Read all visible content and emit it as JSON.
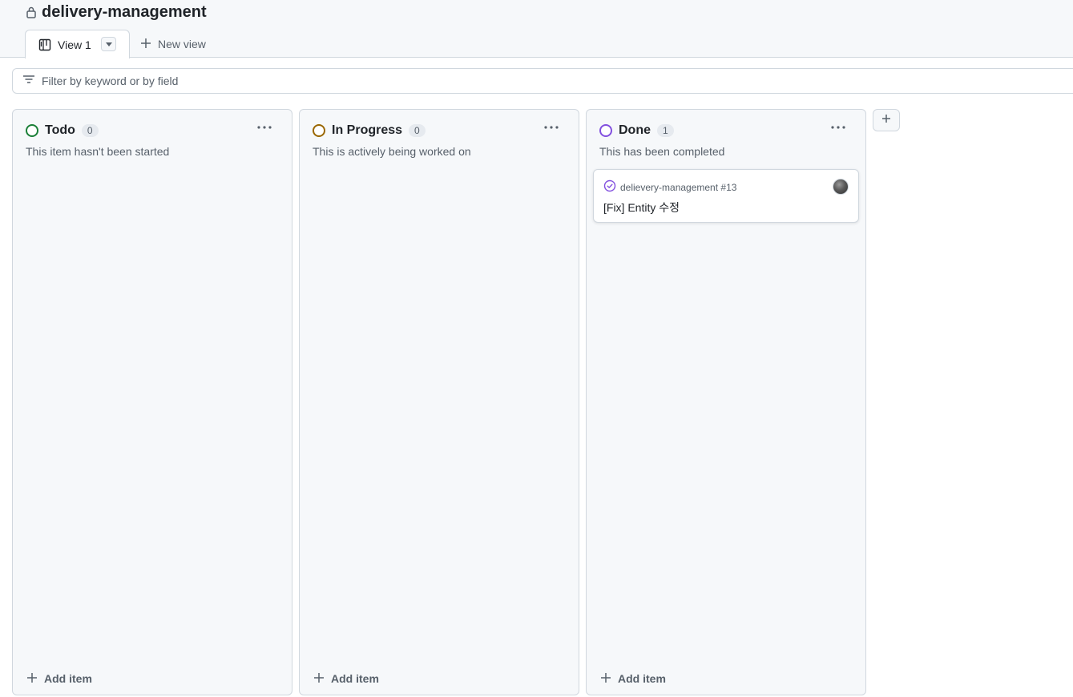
{
  "project": {
    "title": "delivery-management"
  },
  "tabs": {
    "active_label": "View 1",
    "new_view_label": "New view"
  },
  "filter": {
    "placeholder": "Filter by keyword or by field",
    "value": ""
  },
  "columns": [
    {
      "name": "Todo",
      "count": "0",
      "description": "This item hasn't been started",
      "status_color": "#1a7f37",
      "add_label": "Add item"
    },
    {
      "name": "In Progress",
      "count": "0",
      "description": "This is actively being worked on",
      "status_color": "#9a6700",
      "add_label": "Add item"
    },
    {
      "name": "Done",
      "count": "1",
      "description": "This has been completed",
      "status_color": "#8250df",
      "add_label": "Add item",
      "cards": [
        {
          "reference": "delievery-management #13",
          "title": "[Fix] Entity 수정",
          "icon": "issue-closed-icon",
          "icon_color": "#8250df"
        }
      ]
    }
  ],
  "icons": {
    "lock": "lock-icon",
    "board": "project-board-icon",
    "filter": "filter-icon",
    "plus": "plus-icon",
    "kebab": "kebab-horizontal-icon"
  }
}
